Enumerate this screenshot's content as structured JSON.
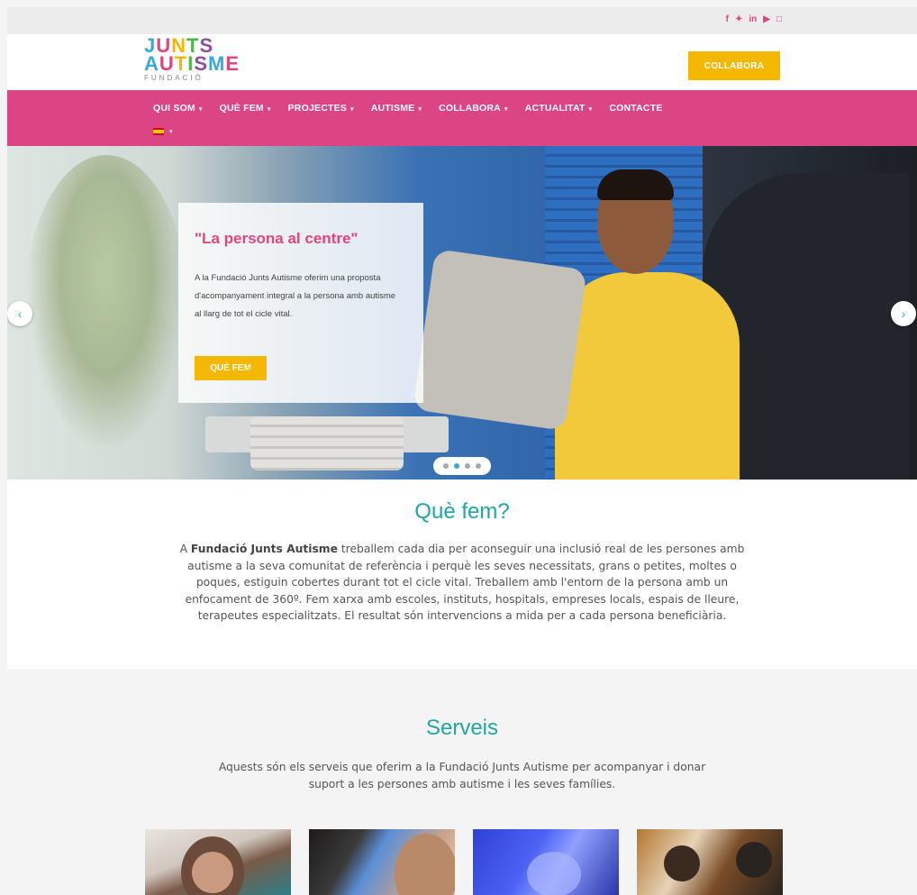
{
  "social": {
    "icons": [
      "f",
      "✦",
      "in",
      "▶",
      "□"
    ],
    "icon_names": [
      "facebook-icon",
      "twitter-icon",
      "linkedin-icon",
      "youtube-icon",
      "instagram-icon"
    ]
  },
  "logo": {
    "line1": "JUNTS",
    "line2": "AUTISME",
    "line3": "FUNDACIÓ"
  },
  "header": {
    "cta_label": "COLLABORA"
  },
  "nav": {
    "items": [
      {
        "label": "QUI SOM",
        "caret": "▾"
      },
      {
        "label": "QUÈ FEM",
        "caret": "▾"
      },
      {
        "label": "PROJECTES",
        "caret": "▾"
      },
      {
        "label": "AUTISME",
        "caret": "▾"
      },
      {
        "label": "COLLABORA",
        "caret": "▾"
      },
      {
        "label": "ACTUALITAT",
        "caret": "▾"
      },
      {
        "label": "CONTACTE",
        "caret": ""
      }
    ],
    "lang_caret": "▾"
  },
  "hero": {
    "title": "\"La persona al centre\"",
    "text": "A la Fundació Junts Autisme oferim una proposta d'acompanyament integral a la persona amb autisme al llarg de tot el cicle vital.",
    "button": "QUÈ FEM",
    "prev": "‹",
    "next": "›",
    "slides_total": 4,
    "slide_active": 2
  },
  "que_fem": {
    "title": "Què fem?",
    "text_pre": "A ",
    "text_bold": "Fundació Junts Autisme",
    "text_post": " treballem cada dia per aconseguir una inclusió real de les persones amb autisme a la seva comunitat de referència i perquè les seves necessitats, grans o petites, moltes o poques, estiguin cobertes durant tot el cicle vital. Treballem amb l'entorn de la persona amb un enfocament de 360º. Fem xarxa amb escoles, instituts, hospitals, empreses locals, espais de lleure, terapeutes especialitzats. El resultat són intervencions a mida per a cada persona beneficiària."
  },
  "serveis": {
    "title": "Serveis",
    "text": "Aquests són els serveis que oferim a la Fundació Junts Autisme per acompanyar i donar suport a les persones amb autisme i les seves famílies."
  },
  "colors": {
    "pink": "#dc4584",
    "yellow": "#f5b800",
    "teal": "#1fa6a0",
    "blue": "#3aa8d8"
  }
}
